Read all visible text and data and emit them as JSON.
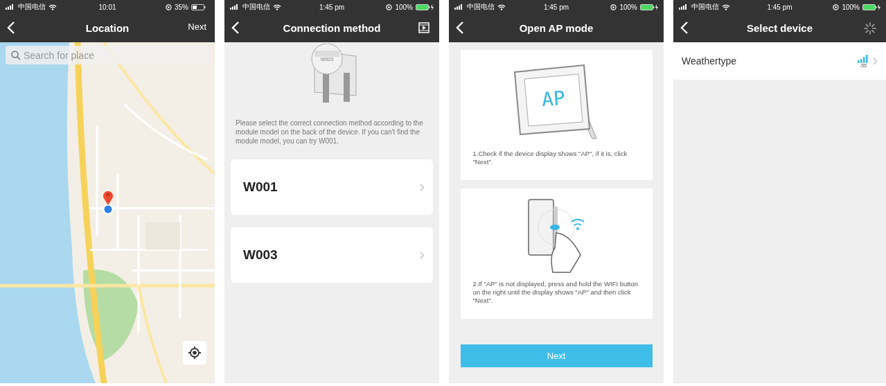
{
  "screens": [
    {
      "kind": "map",
      "status_bar": {
        "carrier": "中国电信",
        "time": "10:01",
        "battery": "35%",
        "charging": false
      },
      "nav": {
        "title": "Location",
        "action": "Next"
      },
      "search": {
        "placeholder": "Search for place"
      }
    },
    {
      "kind": "methods",
      "status_bar": {
        "carrier": "中国电信",
        "time": "1:45 pm",
        "battery": "100%",
        "charging": true
      },
      "nav": {
        "title": "Connection method"
      },
      "illustration_label": "W003",
      "note": "Please select the correct connection method according to the module model on the back of the device. If you can't find the module model, you can try W001.",
      "options": [
        {
          "label": "W001"
        },
        {
          "label": "W003"
        }
      ]
    },
    {
      "kind": "steps",
      "status_bar": {
        "carrier": "中国电信",
        "time": "1:45 pm",
        "battery": "100%",
        "charging": true
      },
      "nav": {
        "title": "Open AP mode"
      },
      "steps": [
        {
          "kind": "display",
          "display_text": "AP",
          "text": "1.Check if the device display shows \"AP\", if it is, click \"Next\"."
        },
        {
          "kind": "button",
          "text": "2.If \"AP\" is not displayed, press and hold the WIFI button on the right until the display shows \"AP\" and then click \"Next\"."
        }
      ],
      "button": "Next"
    },
    {
      "kind": "devices",
      "status_bar": {
        "carrier": "中国电信",
        "time": "1:45 pm",
        "battery": "100%",
        "charging": true
      },
      "nav": {
        "title": "Select device"
      },
      "devices": [
        {
          "name": "Weathertype",
          "signal": "-55"
        }
      ]
    }
  ]
}
